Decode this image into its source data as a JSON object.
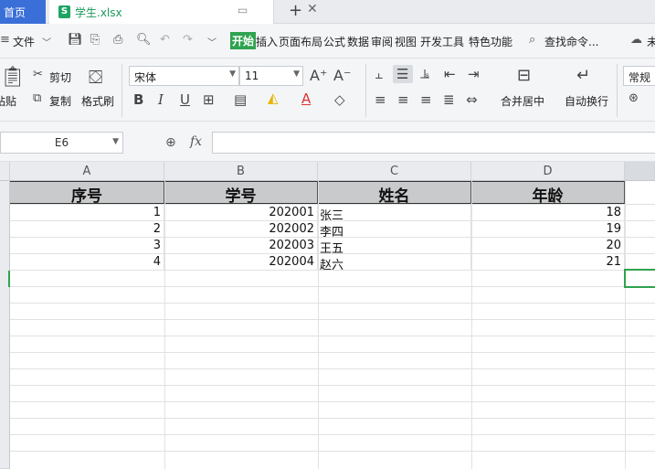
{
  "tabs": {
    "home": "首页",
    "file_icon_letter": "S",
    "file_name": "学生.xlsx",
    "add": "+"
  },
  "menu": {
    "file": "文件",
    "items": [
      "开始",
      "插入",
      "页面布局",
      "公式",
      "数据",
      "审阅",
      "视图",
      "开发工具",
      "特色功能"
    ],
    "search": "查找命令...",
    "cloud": "未"
  },
  "ribbon": {
    "paste": "粘贴",
    "cut": "剪切",
    "copy": "复制",
    "format_painter": "格式刷",
    "font_name": "宋体",
    "font_size": "11",
    "bold": "B",
    "italic": "I",
    "underline": "U",
    "merge_center": "合并居中",
    "wrap_text": "自动换行",
    "number_format": "常规",
    "currency": "¥"
  },
  "formula_bar": {
    "name_box": "E6",
    "fx": "fx",
    "content": ""
  },
  "sheet": {
    "columns": [
      "A",
      "B",
      "C",
      "D"
    ],
    "header_row": [
      "序号",
      "学号",
      "姓名",
      "年龄"
    ],
    "rows": [
      {
        "seq": "1",
        "id": "202001",
        "name": "张三",
        "age": "18"
      },
      {
        "seq": "2",
        "id": "202002",
        "name": "李四",
        "age": "19"
      },
      {
        "seq": "3",
        "id": "202003",
        "name": "王五",
        "age": "20"
      },
      {
        "seq": "4",
        "id": "202004",
        "name": "赵六",
        "age": "21"
      }
    ],
    "selected_cell": "E6"
  },
  "colors": {
    "accent_green": "#2fa34f",
    "home_tab_blue": "#3a6fd8",
    "header_fill": "#c9cacc"
  }
}
